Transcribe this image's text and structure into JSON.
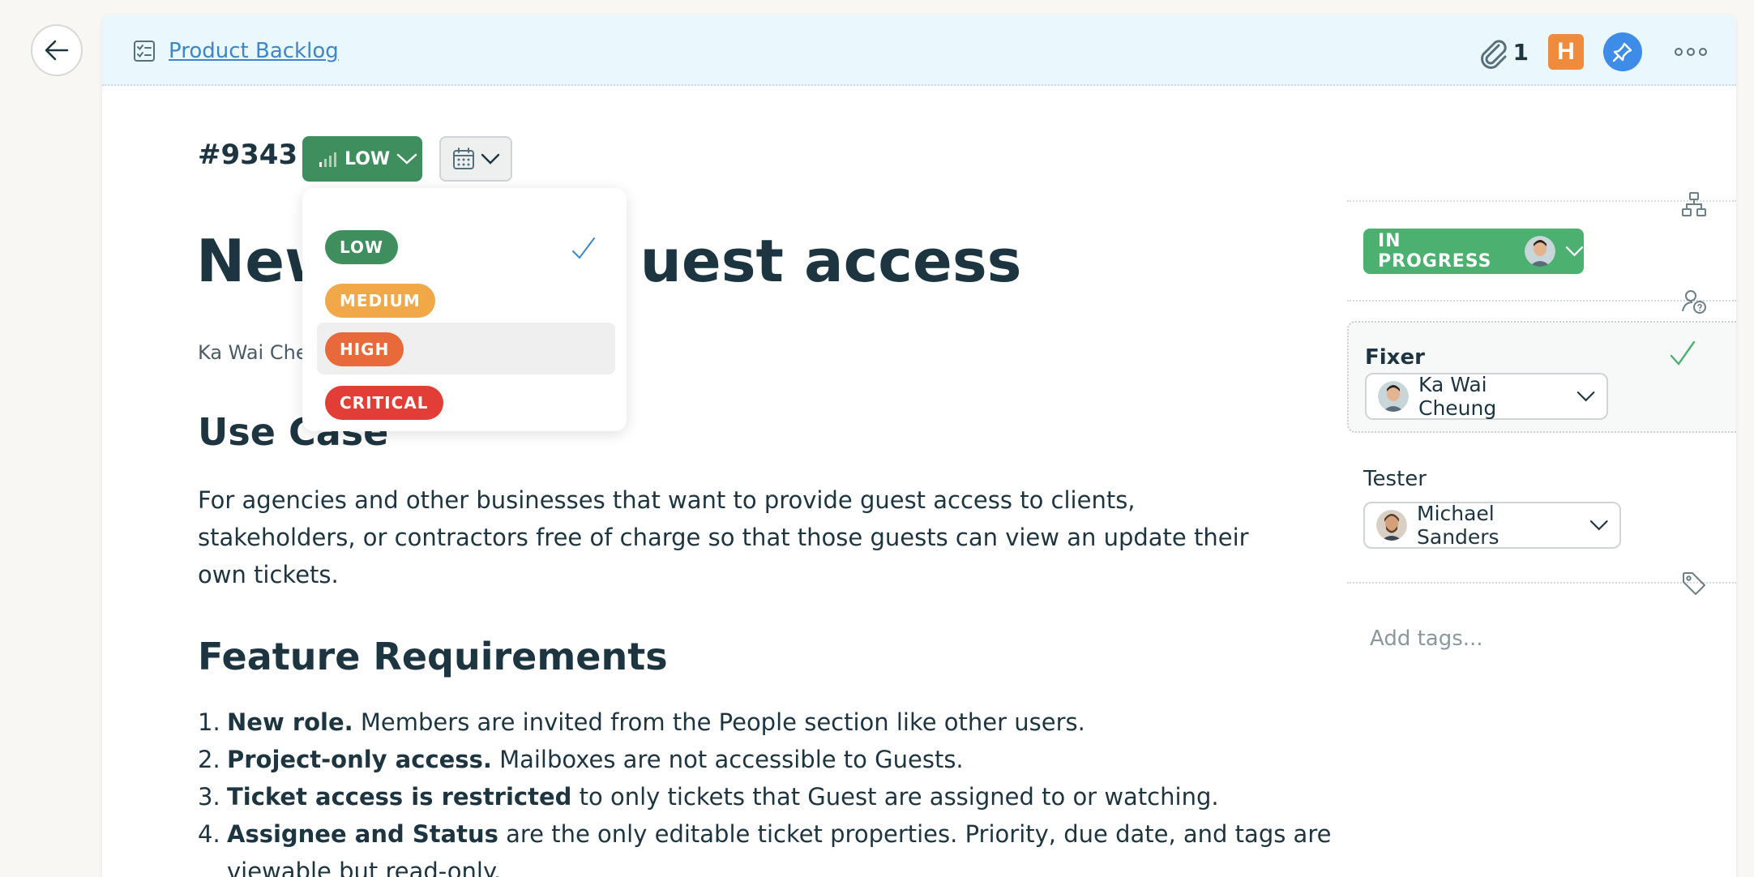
{
  "breadcrumb": {
    "label": "Product Backlog"
  },
  "toolbar": {
    "attachment_count": "1",
    "badge_letter": "H"
  },
  "ticket": {
    "id": "#9343",
    "priority_label": "LOW",
    "title_left": "New",
    "title_right": "uest access",
    "author": "Ka Wai Che"
  },
  "priority_menu": {
    "options": [
      {
        "label": "LOW",
        "color": "#3f8f5e",
        "selected": true
      },
      {
        "label": "MEDIUM",
        "color": "#f0a848"
      },
      {
        "label": "HIGH",
        "color": "#e8693a"
      },
      {
        "label": "CRITICAL",
        "color": "#e23d37"
      }
    ]
  },
  "sections": {
    "use_case": {
      "heading": "Use Case",
      "body": "For agencies and other businesses that want to provide guest access to clients, stakeholders, or contractors free of charge so that those guests can view an update their own tickets."
    },
    "feature_requirements": {
      "heading": "Feature Requirements",
      "items": [
        {
          "num": "1.",
          "bold": "New role.",
          "text": " Members are invited from the People section like other users."
        },
        {
          "num": "2.",
          "bold": "Project-only access.",
          "text": " Mailboxes are not accessible to Guests."
        },
        {
          "num": "3.",
          "bold": "Ticket access is restricted",
          "text": " to only tickets that Guest are assigned to or watching."
        },
        {
          "num": "4.",
          "bold": "Assignee and Status",
          "text": " are the only editable ticket properties. Priority, due date, and tags are viewable but read-only."
        }
      ]
    }
  },
  "sidebar": {
    "status_label": "IN PROGRESS",
    "fixer": {
      "label": "Fixer",
      "name": "Ka Wai Cheung"
    },
    "tester": {
      "label": "Tester",
      "name": "Michael Sanders"
    },
    "tags_placeholder": "Add tags..."
  },
  "colors": {
    "priority_low": "#3f8f5e",
    "status_in_progress": "#4cb071",
    "link": "#3c86c9",
    "header_bg": "#eaf7fc"
  }
}
